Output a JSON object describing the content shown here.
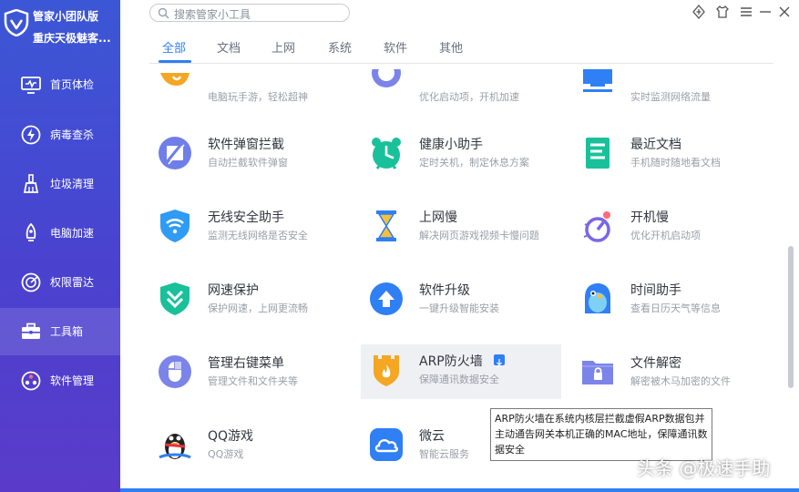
{
  "app": {
    "brand_name": "管家小团队版",
    "user_name": "重庆天极魅客..."
  },
  "sidebar": {
    "items": [
      {
        "label": "首页体检",
        "icon": "monitor-check-icon"
      },
      {
        "label": "病毒查杀",
        "icon": "lightning-shield-icon"
      },
      {
        "label": "垃圾清理",
        "icon": "broom-icon"
      },
      {
        "label": "电脑加速",
        "icon": "rocket-icon"
      },
      {
        "label": "权限雷达",
        "icon": "radar-icon"
      },
      {
        "label": "工具箱",
        "icon": "toolbox-icon",
        "active": true
      },
      {
        "label": "软件管理",
        "icon": "apps-icon"
      }
    ]
  },
  "search": {
    "placeholder": "搜索管家小工具"
  },
  "tabs": [
    "全部",
    "文档",
    "上网",
    "系统",
    "软件",
    "其他"
  ],
  "active_tab": "全部",
  "tools": {
    "row0": [
      {
        "name": "",
        "desc": "电脑玩手游，轻松超神"
      },
      {
        "name": "",
        "desc": "优化启动项，开机加速"
      },
      {
        "name": "",
        "desc": "实时监测网络流量"
      }
    ],
    "row1": [
      {
        "name": "软件弹窗拦截",
        "desc": "自动拦截软件弹窗"
      },
      {
        "name": "健康小助手",
        "desc": "定时关机，制定休息方案"
      },
      {
        "name": "最近文档",
        "desc": "手机随时随地看文档"
      }
    ],
    "row2": [
      {
        "name": "无线安全助手",
        "desc": "监测无线网络是否安全"
      },
      {
        "name": "上网慢",
        "desc": "解决网页游戏视频卡慢问题"
      },
      {
        "name": "开机慢",
        "desc": "优化开机启动项"
      }
    ],
    "row3": [
      {
        "name": "网速保护",
        "desc": "保护网速，上网更流畅"
      },
      {
        "name": "软件升级",
        "desc": "一键升级智能安装"
      },
      {
        "name": "时间助手",
        "desc": "查看日历天气等信息"
      }
    ],
    "row4": [
      {
        "name": "管理右键菜单",
        "desc": "管理文件和文件夹等"
      },
      {
        "name": "ARP防火墙",
        "desc": "保障通讯数据安全",
        "hovered": true
      },
      {
        "name": "文件解密",
        "desc": "解密被木马加密的文件"
      }
    ],
    "row5": [
      {
        "name": "QQ游戏",
        "desc": "QQ游戏"
      },
      {
        "name": "微云",
        "desc": "智能云服务"
      }
    ]
  },
  "tooltip": {
    "text": "ARP防火墙在系统内核层拦截虚假ARP数据包并主动通告网关本机正确的MAC地址，保障通讯数据安全"
  },
  "watermark": {
    "text": "头条 @极速手助"
  },
  "colors": {
    "accent": "#2f7ff5",
    "sidebar_top": "#3b57d6",
    "sidebar_bottom": "#5a3bc9"
  }
}
